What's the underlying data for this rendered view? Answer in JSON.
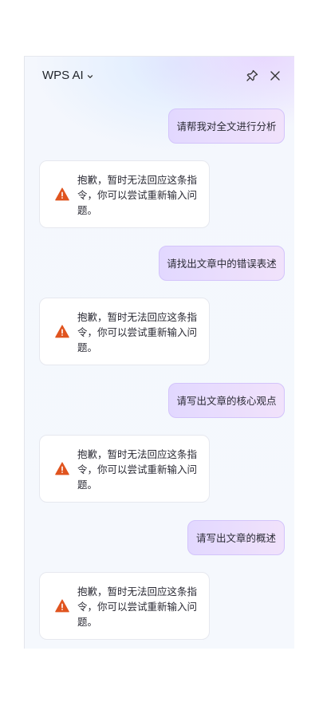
{
  "header": {
    "title": "WPS AI",
    "icons": [
      "chevron-down-icon",
      "pin-icon",
      "close-icon"
    ]
  },
  "messages": [
    {
      "role": "user",
      "text": "请帮我对全文进行分析"
    },
    {
      "role": "assistant",
      "icon": "warning-icon",
      "text": "抱歉，暂时无法回应这条指令，你可以尝试重新输入问题。"
    },
    {
      "role": "user",
      "text": "请找出文章中的错误表述"
    },
    {
      "role": "assistant",
      "icon": "warning-icon",
      "text": "抱歉，暂时无法回应这条指令，你可以尝试重新输入问题。"
    },
    {
      "role": "user",
      "text": "请写出文章的核心观点"
    },
    {
      "role": "assistant",
      "icon": "warning-icon",
      "text": "抱歉，暂时无法回应这条指令，你可以尝试重新输入问题。"
    },
    {
      "role": "user",
      "text": "请写出文章的概述"
    },
    {
      "role": "assistant",
      "icon": "warning-icon",
      "text": "抱歉，暂时无法回应这条指令，你可以尝试重新输入问题。"
    }
  ],
  "colors": {
    "warning": "#e0541f",
    "user_bubble_start": "#e2d8ff",
    "user_bubble_end": "#f1e2fb"
  }
}
